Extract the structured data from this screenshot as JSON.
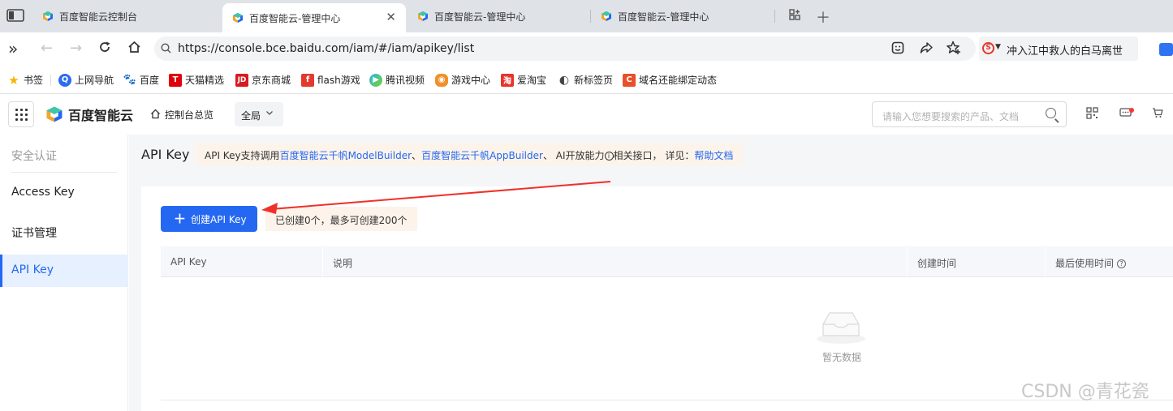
{
  "browser": {
    "tabs": [
      {
        "label": "百度智能云控制台"
      },
      {
        "label": "百度智能云-管理中心"
      },
      {
        "label": "百度智能云-管理中心"
      },
      {
        "label": "百度智能云-管理中心"
      }
    ],
    "url": "https://console.bce.baidu.com/iam/#/iam/apikey/list",
    "hot_search": "冲入江中救人的白马离世",
    "bookmarks": [
      {
        "label": "书签",
        "icon": "star-icon"
      },
      {
        "label": "上网导航",
        "icon": "nav-icon"
      },
      {
        "label": "百度",
        "icon": "baidu-icon"
      },
      {
        "label": "天猫精选",
        "icon": "tmall-icon"
      },
      {
        "label": "京东商城",
        "icon": "jd-icon"
      },
      {
        "label": "flash游戏",
        "icon": "flash-icon"
      },
      {
        "label": "腾讯视频",
        "icon": "video-icon"
      },
      {
        "label": "游戏中心",
        "icon": "game-icon"
      },
      {
        "label": "爱淘宝",
        "icon": "taobao-icon"
      },
      {
        "label": "新标签页",
        "icon": "newtab-icon"
      },
      {
        "label": "域名还能绑定动态",
        "icon": "csdn-icon"
      }
    ]
  },
  "console": {
    "brand": "百度智能云",
    "overview": "控制台总览",
    "scope": "全局",
    "search_placeholder": "请输入您想要搜索的产品、文档"
  },
  "sidebar": {
    "title": "安全认证",
    "items": [
      {
        "label": "Access Key"
      },
      {
        "label": "证书管理"
      },
      {
        "label": "API Key"
      }
    ]
  },
  "main": {
    "title": "API Key",
    "notice": {
      "prefix": "API Key支持调用",
      "link1": "百度智能云千帆ModelBuilder",
      "sep": "、",
      "link2": "百度智能云千帆AppBuilder",
      "mid": "、 AI开放能力",
      "info": "i",
      "suffix": "相关接口， 详见：",
      "link3": "帮助文档"
    },
    "create_button": "创建API Key",
    "quota": "已创建0个，最多可创建200个",
    "columns": [
      "API Key",
      "说明",
      "创建时间",
      "最后使用时间"
    ],
    "empty_text": "暂无数据"
  },
  "watermark": "CSDN @青花瓷",
  "colors": {
    "accent": "#2468f2",
    "notice_bg": "#fcf3ea",
    "arrow": "#f0302a"
  }
}
